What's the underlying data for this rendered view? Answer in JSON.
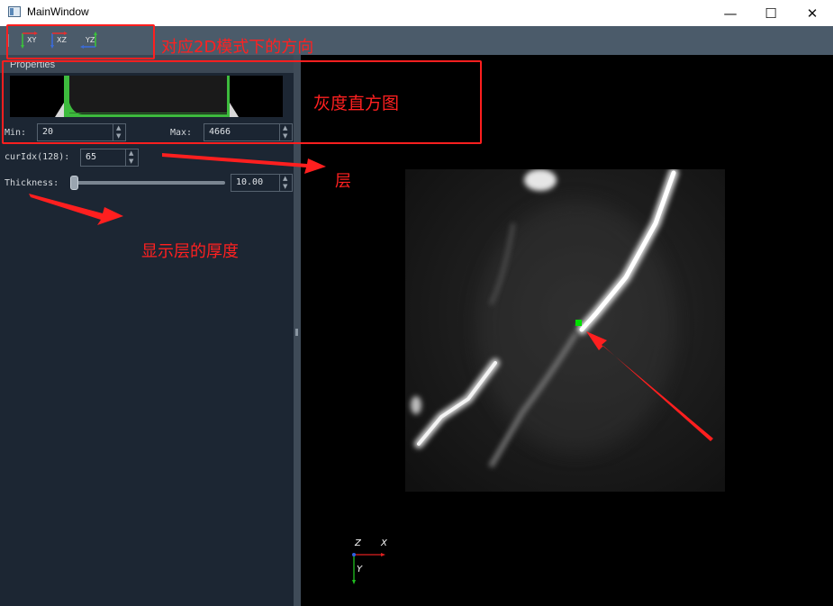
{
  "window": {
    "title": "MainWindow",
    "controls": {
      "minimize": "—",
      "maximize": "☐",
      "close": "✕"
    }
  },
  "toolbar": {
    "buttons": [
      {
        "label": "XY",
        "icon": "xy-axis-icon"
      },
      {
        "label": "XZ",
        "icon": "xz-axis-icon"
      },
      {
        "label": "YZ",
        "icon": "yz-axis-icon"
      }
    ]
  },
  "properties": {
    "title": "Properties",
    "min_label": "Min:",
    "min_value": "20",
    "max_label": "Max:",
    "max_value": "4666",
    "curidx_label": "curIdx(128):",
    "curidx_value": "65",
    "thickness_label": "Thickness:",
    "thickness_value": "10.00",
    "thickness_slider_fraction": 0.0
  },
  "viewport": {
    "axes": {
      "z": "Z",
      "x": "X",
      "y": "Y"
    },
    "marker_color": "#00e000"
  },
  "annotations": {
    "orientation": "对应2D模式下的方向",
    "histogram": "灰度直方图",
    "layer": "层",
    "thickness": "显示层的厚度"
  },
  "colors": {
    "annotation_red": "#ff1f1f",
    "histogram_green": "#3dbb3d",
    "panel_bg": "#1c2633"
  }
}
